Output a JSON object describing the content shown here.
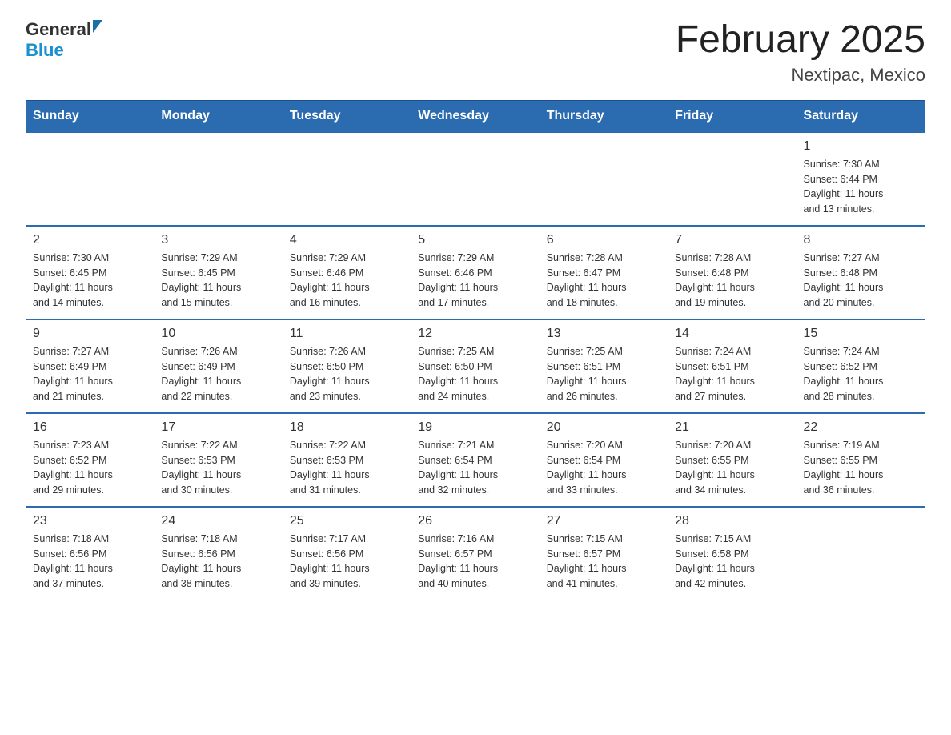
{
  "logo": {
    "general": "General",
    "blue": "Blue"
  },
  "title": "February 2025",
  "location": "Nextipac, Mexico",
  "days_of_week": [
    "Sunday",
    "Monday",
    "Tuesday",
    "Wednesday",
    "Thursday",
    "Friday",
    "Saturday"
  ],
  "weeks": [
    [
      {
        "day": "",
        "info": ""
      },
      {
        "day": "",
        "info": ""
      },
      {
        "day": "",
        "info": ""
      },
      {
        "day": "",
        "info": ""
      },
      {
        "day": "",
        "info": ""
      },
      {
        "day": "",
        "info": ""
      },
      {
        "day": "1",
        "info": "Sunrise: 7:30 AM\nSunset: 6:44 PM\nDaylight: 11 hours\nand 13 minutes."
      }
    ],
    [
      {
        "day": "2",
        "info": "Sunrise: 7:30 AM\nSunset: 6:45 PM\nDaylight: 11 hours\nand 14 minutes."
      },
      {
        "day": "3",
        "info": "Sunrise: 7:29 AM\nSunset: 6:45 PM\nDaylight: 11 hours\nand 15 minutes."
      },
      {
        "day": "4",
        "info": "Sunrise: 7:29 AM\nSunset: 6:46 PM\nDaylight: 11 hours\nand 16 minutes."
      },
      {
        "day": "5",
        "info": "Sunrise: 7:29 AM\nSunset: 6:46 PM\nDaylight: 11 hours\nand 17 minutes."
      },
      {
        "day": "6",
        "info": "Sunrise: 7:28 AM\nSunset: 6:47 PM\nDaylight: 11 hours\nand 18 minutes."
      },
      {
        "day": "7",
        "info": "Sunrise: 7:28 AM\nSunset: 6:48 PM\nDaylight: 11 hours\nand 19 minutes."
      },
      {
        "day": "8",
        "info": "Sunrise: 7:27 AM\nSunset: 6:48 PM\nDaylight: 11 hours\nand 20 minutes."
      }
    ],
    [
      {
        "day": "9",
        "info": "Sunrise: 7:27 AM\nSunset: 6:49 PM\nDaylight: 11 hours\nand 21 minutes."
      },
      {
        "day": "10",
        "info": "Sunrise: 7:26 AM\nSunset: 6:49 PM\nDaylight: 11 hours\nand 22 minutes."
      },
      {
        "day": "11",
        "info": "Sunrise: 7:26 AM\nSunset: 6:50 PM\nDaylight: 11 hours\nand 23 minutes."
      },
      {
        "day": "12",
        "info": "Sunrise: 7:25 AM\nSunset: 6:50 PM\nDaylight: 11 hours\nand 24 minutes."
      },
      {
        "day": "13",
        "info": "Sunrise: 7:25 AM\nSunset: 6:51 PM\nDaylight: 11 hours\nand 26 minutes."
      },
      {
        "day": "14",
        "info": "Sunrise: 7:24 AM\nSunset: 6:51 PM\nDaylight: 11 hours\nand 27 minutes."
      },
      {
        "day": "15",
        "info": "Sunrise: 7:24 AM\nSunset: 6:52 PM\nDaylight: 11 hours\nand 28 minutes."
      }
    ],
    [
      {
        "day": "16",
        "info": "Sunrise: 7:23 AM\nSunset: 6:52 PM\nDaylight: 11 hours\nand 29 minutes."
      },
      {
        "day": "17",
        "info": "Sunrise: 7:22 AM\nSunset: 6:53 PM\nDaylight: 11 hours\nand 30 minutes."
      },
      {
        "day": "18",
        "info": "Sunrise: 7:22 AM\nSunset: 6:53 PM\nDaylight: 11 hours\nand 31 minutes."
      },
      {
        "day": "19",
        "info": "Sunrise: 7:21 AM\nSunset: 6:54 PM\nDaylight: 11 hours\nand 32 minutes."
      },
      {
        "day": "20",
        "info": "Sunrise: 7:20 AM\nSunset: 6:54 PM\nDaylight: 11 hours\nand 33 minutes."
      },
      {
        "day": "21",
        "info": "Sunrise: 7:20 AM\nSunset: 6:55 PM\nDaylight: 11 hours\nand 34 minutes."
      },
      {
        "day": "22",
        "info": "Sunrise: 7:19 AM\nSunset: 6:55 PM\nDaylight: 11 hours\nand 36 minutes."
      }
    ],
    [
      {
        "day": "23",
        "info": "Sunrise: 7:18 AM\nSunset: 6:56 PM\nDaylight: 11 hours\nand 37 minutes."
      },
      {
        "day": "24",
        "info": "Sunrise: 7:18 AM\nSunset: 6:56 PM\nDaylight: 11 hours\nand 38 minutes."
      },
      {
        "day": "25",
        "info": "Sunrise: 7:17 AM\nSunset: 6:56 PM\nDaylight: 11 hours\nand 39 minutes."
      },
      {
        "day": "26",
        "info": "Sunrise: 7:16 AM\nSunset: 6:57 PM\nDaylight: 11 hours\nand 40 minutes."
      },
      {
        "day": "27",
        "info": "Sunrise: 7:15 AM\nSunset: 6:57 PM\nDaylight: 11 hours\nand 41 minutes."
      },
      {
        "day": "28",
        "info": "Sunrise: 7:15 AM\nSunset: 6:58 PM\nDaylight: 11 hours\nand 42 minutes."
      },
      {
        "day": "",
        "info": ""
      }
    ]
  ]
}
